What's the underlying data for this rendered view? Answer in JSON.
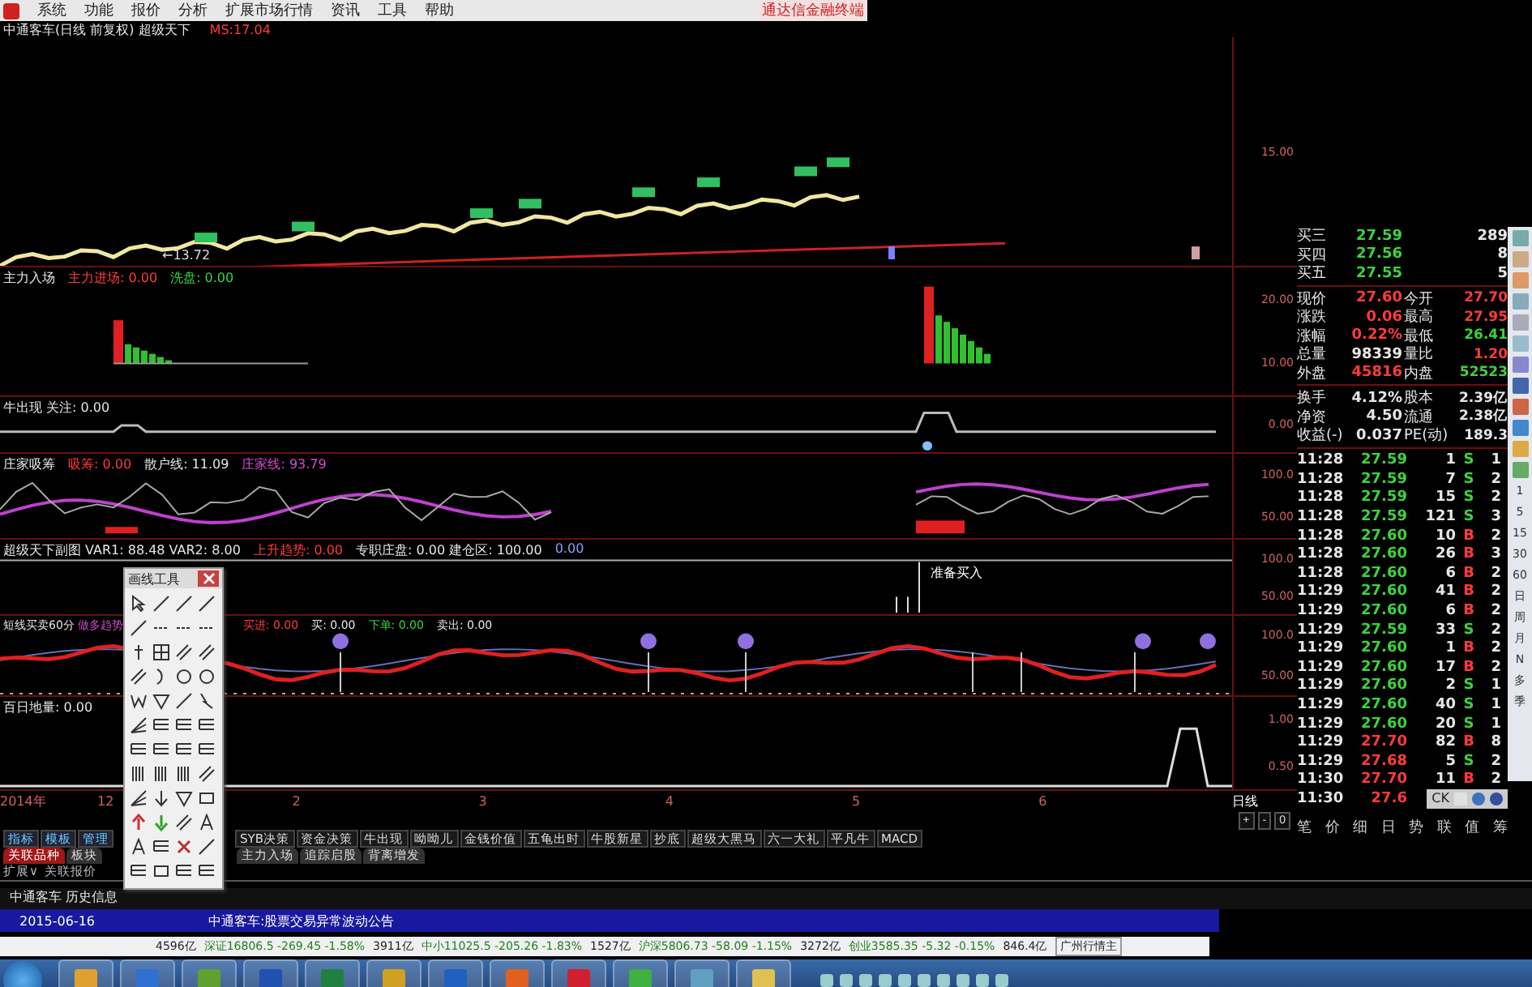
{
  "menu": {
    "items": [
      "系统",
      "功能",
      "报价",
      "分析",
      "扩展市场行情",
      "资讯",
      "工具",
      "帮助"
    ],
    "brand": "通达信金融终端"
  },
  "title_bar": {
    "title": "中通客车(日线 前复权) 超级天下",
    "reading": "MS:17.04"
  },
  "panels": [
    {
      "kind": "price",
      "axis": [
        "15.00"
      ],
      "note": "←13.72"
    },
    {
      "kind": "bars",
      "label": [
        {
          "text": "主力入场",
          "color": "#e6e6e6"
        },
        {
          "text": "主力进场: 0.00",
          "color": "#ff3b3b"
        },
        {
          "text": "洗盘: 0.00",
          "color": "#3bd43b"
        }
      ],
      "axis": [
        "20.00",
        "10.00"
      ]
    },
    {
      "kind": "line",
      "label": [
        {
          "text": "牛出现 关注: 0.00",
          "color": "#e6e6e6"
        }
      ],
      "axis": [
        "0.00"
      ]
    },
    {
      "kind": "dual",
      "label": [
        {
          "text": "庄家吸筹",
          "color": "#e6e6e6"
        },
        {
          "text": "吸筹: 0.00",
          "color": "#ff3b3b"
        },
        {
          "text": "散户线: 11.09",
          "color": "#e6e6e6"
        },
        {
          "text": "庄家线: 93.79",
          "color": "#d24bd2"
        }
      ],
      "axis": [
        "100.0",
        "50.00"
      ]
    },
    {
      "kind": "signal",
      "label": [
        {
          "text": "超级天下副图 VAR1: 88.48 VAR2: 8.00",
          "color": "#e6e6e6"
        },
        {
          "text": "上升趋势: 0.00",
          "color": "#ff3b3b"
        },
        {
          "text": "专职庄盘: 0.00 建仓区: 100.00",
          "color": "#e6e6e6"
        },
        {
          "text": "0.00",
          "color": "#8aa0ff"
        }
      ],
      "axis": [
        "100.0",
        "50.00"
      ],
      "note": "准备买入"
    },
    {
      "kind": "wave",
      "label": [
        {
          "text": "短线买卖60分",
          "color": "#e6e6e6"
        },
        {
          "text": "做多趋势",
          "color": "#d24bd2"
        },
        {
          "text": "买进: 0.00",
          "color": "#ff3b3b"
        },
        {
          "text": "买: 0.00",
          "color": "#e6e6e6"
        },
        {
          "text": "下单: 0.00",
          "color": "#3bd43b"
        },
        {
          "text": "卖出: 0.00",
          "color": "#e6e6e6"
        }
      ],
      "axis": [
        "100.0",
        "50.00"
      ]
    },
    {
      "kind": "spike",
      "label": [
        {
          "text": "百日地量: 0.00",
          "color": "#e6e6e6"
        }
      ],
      "axis": [
        "1.00",
        "0.50"
      ]
    }
  ],
  "time_axis": {
    "year": "2014年",
    "marks": [
      "12",
      "2",
      "3",
      "4",
      "5",
      "6"
    ]
  },
  "period": {
    "label": "日线",
    "controls": [
      "+",
      "-",
      "0"
    ]
  },
  "quote": {
    "levels": [
      {
        "label": "买三",
        "price": "27.59",
        "volume": "289"
      },
      {
        "label": "买四",
        "price": "27.56",
        "volume": "8"
      },
      {
        "label": "买五",
        "price": "27.55",
        "volume": "5"
      }
    ],
    "stats": [
      {
        "left": {
          "label": "现价",
          "value": "27.60",
          "color": "#ff3b3b"
        },
        "right": {
          "label": "今开",
          "value": "27.70",
          "color": "#ff3b3b"
        }
      },
      {
        "left": {
          "label": "涨跌",
          "value": "0.06",
          "color": "#ff3b3b"
        },
        "right": {
          "label": "最高",
          "value": "27.95",
          "color": "#ff3b3b"
        }
      },
      {
        "left": {
          "label": "涨幅",
          "value": "0.22%",
          "color": "#ff3b3b"
        },
        "right": {
          "label": "最低",
          "value": "26.41",
          "color": "#3bd43b"
        }
      },
      {
        "left": {
          "label": "总量",
          "value": "98339",
          "color": "#e6e6e6"
        },
        "right": {
          "label": "量比",
          "value": "1.20",
          "color": "#ff3b3b"
        }
      },
      {
        "left": {
          "label": "外盘",
          "value": "45816",
          "color": "#ff3b3b"
        },
        "right": {
          "label": "内盘",
          "value": "52523",
          "color": "#3bd43b"
        }
      },
      {
        "left": {
          "label": "换手",
          "value": "4.12%",
          "color": "#e6e6e6"
        },
        "right": {
          "label": "股本",
          "value": "2.39亿",
          "color": "#e6e6e6"
        }
      },
      {
        "left": {
          "label": "净资",
          "value": "4.50",
          "color": "#e6e6e6"
        },
        "right": {
          "label": "流通",
          "value": "2.38亿",
          "color": "#e6e6e6"
        }
      },
      {
        "left": {
          "label": "收益(-)",
          "value": "0.037",
          "color": "#e6e6e6"
        },
        "right": {
          "label": "PE(动)",
          "value": "189.3",
          "color": "#e6e6e6"
        }
      }
    ],
    "ticks": [
      {
        "time": "11:28",
        "price": "27.59",
        "up": false,
        "volume": "1",
        "side": "S",
        "buy": false,
        "count": "1"
      },
      {
        "time": "11:28",
        "price": "27.59",
        "up": false,
        "volume": "7",
        "side": "S",
        "buy": false,
        "count": "2"
      },
      {
        "time": "11:28",
        "price": "27.59",
        "up": false,
        "volume": "15",
        "side": "S",
        "buy": false,
        "count": "2"
      },
      {
        "time": "11:28",
        "price": "27.59",
        "up": false,
        "volume": "121",
        "side": "S",
        "buy": false,
        "count": "3"
      },
      {
        "time": "11:28",
        "price": "27.60",
        "up": false,
        "volume": "10",
        "side": "B",
        "buy": true,
        "count": "2"
      },
      {
        "time": "11:28",
        "price": "27.60",
        "up": false,
        "volume": "26",
        "side": "B",
        "buy": true,
        "count": "3"
      },
      {
        "time": "11:28",
        "price": "27.60",
        "up": false,
        "volume": "6",
        "side": "B",
        "buy": true,
        "count": "2"
      },
      {
        "time": "11:29",
        "price": "27.60",
        "up": false,
        "volume": "41",
        "side": "B",
        "buy": true,
        "count": "2"
      },
      {
        "time": "11:29",
        "price": "27.60",
        "up": false,
        "volume": "6",
        "side": "B",
        "buy": true,
        "count": "2"
      },
      {
        "time": "11:29",
        "price": "27.59",
        "up": false,
        "volume": "33",
        "side": "S",
        "buy": false,
        "count": "2"
      },
      {
        "time": "11:29",
        "price": "27.60",
        "up": false,
        "volume": "1",
        "side": "B",
        "buy": true,
        "count": "2"
      },
      {
        "time": "11:29",
        "price": "27.60",
        "up": false,
        "volume": "17",
        "side": "B",
        "buy": true,
        "count": "2"
      },
      {
        "time": "11:29",
        "price": "27.60",
        "up": false,
        "volume": "2",
        "side": "S",
        "buy": false,
        "count": "1"
      },
      {
        "time": "11:29",
        "price": "27.60",
        "up": false,
        "volume": "40",
        "side": "S",
        "buy": false,
        "count": "1"
      },
      {
        "time": "11:29",
        "price": "27.60",
        "up": false,
        "volume": "20",
        "side": "S",
        "buy": false,
        "count": "1"
      },
      {
        "time": "11:29",
        "price": "27.70",
        "up": true,
        "volume": "82",
        "side": "B",
        "buy": true,
        "count": "8"
      },
      {
        "time": "11:29",
        "price": "27.68",
        "up": true,
        "volume": "5",
        "side": "S",
        "buy": false,
        "count": "2"
      },
      {
        "time": "11:30",
        "price": "27.70",
        "up": true,
        "volume": "11",
        "side": "B",
        "buy": true,
        "count": "2"
      },
      {
        "time": "11:30",
        "price": "27.6",
        "up": true
      }
    ],
    "popup": "CK",
    "tabs": [
      {
        "label": "笔",
        "selected": false
      },
      {
        "label": "价",
        "selected": false
      },
      {
        "label": "细",
        "selected": false
      },
      {
        "label": "日",
        "selected": false
      },
      {
        "label": "势",
        "selected": false
      },
      {
        "label": "联",
        "selected": false
      },
      {
        "label": "值",
        "selected": false
      },
      {
        "label": "筹",
        "selected": false
      }
    ]
  },
  "side_toolbar": {
    "periods": [
      "1",
      "5",
      "15",
      "30",
      "60",
      "日",
      "周",
      "月",
      "N",
      "多",
      "季"
    ]
  },
  "indicator_bar": {
    "items": [
      "指标",
      "模板",
      "管理"
    ],
    "items_right": [
      "SYB决策",
      "资金决策",
      "牛出现",
      "呦呦儿",
      "金钱价值",
      "五龟出时",
      "牛股新星",
      "抄底",
      "超级大黑马",
      "六一大礼",
      "平凡牛",
      "MACD"
    ]
  },
  "link_tabs": [
    {
      "label": "关联品种",
      "selected": true
    },
    {
      "label": "板块",
      "selected": false
    }
  ],
  "link_tabs_right": [
    {
      "label": "主力入场",
      "selected": false
    },
    {
      "label": "追踪启股",
      "selected": false
    },
    {
      "label": "背离增发",
      "selected": false
    }
  ],
  "expand_bar": {
    "items": [
      "扩展∨",
      "关联报价"
    ]
  },
  "news": {
    "header": "中通客车 历史信息",
    "headline_date": "2015-06-16",
    "headline": "中通客车:股票交易异常波动公告"
  },
  "index_bar": {
    "items": [
      "4596亿",
      "深证16806.5 -269.45 -1.58%",
      "3911亿",
      "中小11025.5 -205.26 -1.83%",
      "1527亿",
      "沪深5806.73 -58.09 -1.15%",
      "3272亿",
      "创业3585.35 -5.32 -0.15%",
      "846.4亿"
    ],
    "market": "广州行情主"
  },
  "drawing_tools": {
    "title": "画线工具"
  }
}
